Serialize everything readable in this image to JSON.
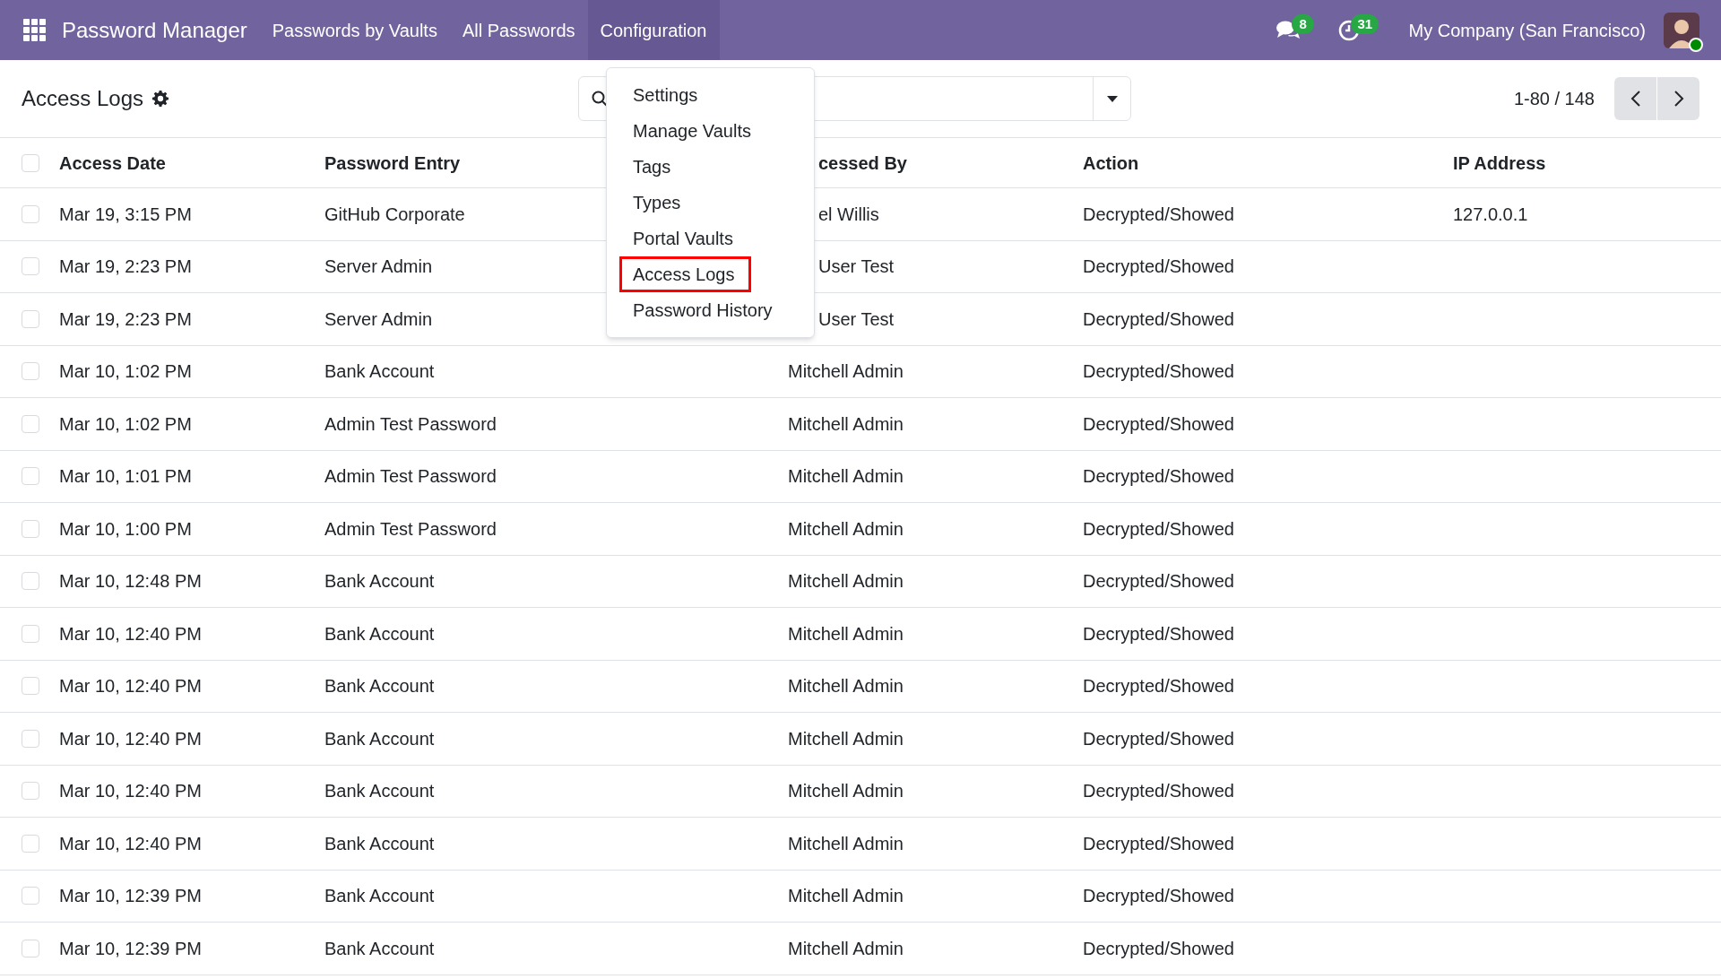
{
  "navbar": {
    "app_title": "Password Manager",
    "menu_items": [
      {
        "label": "Passwords by Vaults",
        "selected": false
      },
      {
        "label": "All Passwords",
        "selected": false
      },
      {
        "label": "Configuration",
        "selected": true
      }
    ],
    "messages_badge": "8",
    "activities_badge": "31",
    "company": "My Company (San Francisco)",
    "user_online": true
  },
  "control_panel": {
    "title": "Access Logs",
    "pager": "1-80 / 148"
  },
  "dropdown": {
    "items": [
      {
        "label": "Settings",
        "selected": false
      },
      {
        "label": "Manage Vaults",
        "selected": false
      },
      {
        "label": "Tags",
        "selected": false
      },
      {
        "label": "Types",
        "selected": false
      },
      {
        "label": "Portal Vaults",
        "selected": false
      },
      {
        "label": "Access Logs",
        "selected": true
      },
      {
        "label": "Password History",
        "selected": false
      }
    ]
  },
  "table": {
    "all_checked": false,
    "columns": [
      {
        "label": "Access Date"
      },
      {
        "label": "Password Entry"
      },
      {
        "label": "cessed By",
        "cut": true
      },
      {
        "label": "Action"
      },
      {
        "label": "IP Address"
      }
    ],
    "rows": [
      {
        "checked": false,
        "access_date": "Mar 19, 3:15 PM",
        "password_entry": "GitHub Corporate",
        "accessed_by": "el Willis",
        "accessed_by_cut": true,
        "action": "Decrypted/Showed",
        "ip_address": "127.0.0.1"
      },
      {
        "checked": false,
        "access_date": "Mar 19, 2:23 PM",
        "password_entry": "Server Admin",
        "accessed_by": "User Test",
        "accessed_by_cut": true,
        "action": "Decrypted/Showed"
      },
      {
        "checked": false,
        "access_date": "Mar 19, 2:23 PM",
        "password_entry": "Server Admin",
        "accessed_by": "User Test",
        "accessed_by_cut": true,
        "action": "Decrypted/Showed"
      },
      {
        "checked": false,
        "access_date": "Mar 10, 1:02 PM",
        "password_entry": "Bank Account",
        "accessed_by": "Mitchell Admin",
        "action": "Decrypted/Showed"
      },
      {
        "checked": false,
        "access_date": "Mar 10, 1:02 PM",
        "password_entry": "Admin Test Password",
        "accessed_by": "Mitchell Admin",
        "action": "Decrypted/Showed"
      },
      {
        "checked": false,
        "access_date": "Mar 10, 1:01 PM",
        "password_entry": "Admin Test Password",
        "accessed_by": "Mitchell Admin",
        "action": "Decrypted/Showed"
      },
      {
        "checked": false,
        "access_date": "Mar 10, 1:00 PM",
        "password_entry": "Admin Test Password",
        "accessed_by": "Mitchell Admin",
        "action": "Decrypted/Showed"
      },
      {
        "checked": false,
        "access_date": "Mar 10, 12:48 PM",
        "password_entry": "Bank Account",
        "accessed_by": "Mitchell Admin",
        "action": "Decrypted/Showed"
      },
      {
        "checked": false,
        "access_date": "Mar 10, 12:40 PM",
        "password_entry": "Bank Account",
        "accessed_by": "Mitchell Admin",
        "action": "Decrypted/Showed"
      },
      {
        "checked": false,
        "access_date": "Mar 10, 12:40 PM",
        "password_entry": "Bank Account",
        "accessed_by": "Mitchell Admin",
        "action": "Decrypted/Showed"
      },
      {
        "checked": false,
        "access_date": "Mar 10, 12:40 PM",
        "password_entry": "Bank Account",
        "accessed_by": "Mitchell Admin",
        "action": "Decrypted/Showed"
      },
      {
        "checked": false,
        "access_date": "Mar 10, 12:40 PM",
        "password_entry": "Bank Account",
        "accessed_by": "Mitchell Admin",
        "action": "Decrypted/Showed"
      },
      {
        "checked": false,
        "access_date": "Mar 10, 12:40 PM",
        "password_entry": "Bank Account",
        "accessed_by": "Mitchell Admin",
        "action": "Decrypted/Showed"
      },
      {
        "checked": false,
        "access_date": "Mar 10, 12:39 PM",
        "password_entry": "Bank Account",
        "accessed_by": "Mitchell Admin",
        "action": "Decrypted/Showed"
      },
      {
        "checked": false,
        "access_date": "Mar 10, 12:39 PM",
        "password_entry": "Bank Account",
        "accessed_by": "Mitchell Admin",
        "action": "Decrypted/Showed"
      }
    ]
  }
}
